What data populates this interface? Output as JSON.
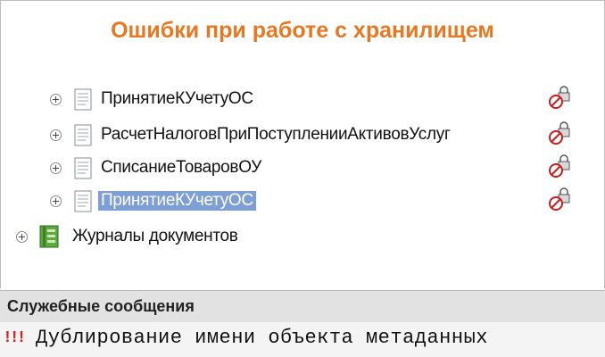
{
  "title": "Ошибки при работе с хранилищем",
  "tree": {
    "items": [
      {
        "label": "ПринятиеКУчетуОС"
      },
      {
        "label": "РасчетНалоговПриПоступленииАктивовУслуг"
      },
      {
        "label": "СписаниеТоваровОУ"
      },
      {
        "label": "ПринятиеКУчетуОС",
        "selected": true
      }
    ],
    "journals_label": "Журналы документов"
  },
  "messages": {
    "header": "Служебные сообщения",
    "mark": "!!!",
    "text": "Дублирование имени объекта метаданных"
  },
  "colors": {
    "title": "#e87722",
    "selection": "#7e9fd4",
    "error_mark": "#e02020"
  }
}
